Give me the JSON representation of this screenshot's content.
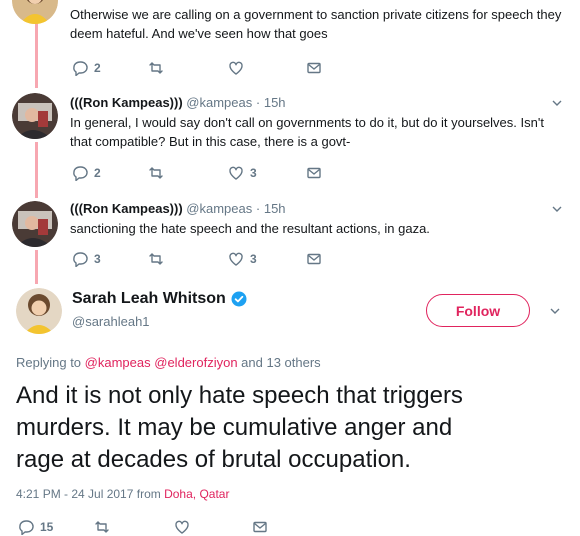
{
  "replies": [
    {
      "text_lines": [
        "Otherwise we are calling on a government to sanction private citizens for speech they",
        "deem hateful. And we've seen how that goes"
      ],
      "reply_count": "2",
      "retweet_count": "",
      "like_count": ""
    },
    {
      "name": "(((Ron Kampeas)))",
      "handle": "@kampeas",
      "separator": "·",
      "time": "15h",
      "text_lines": [
        "In general, I would say don't call on governments to do it,  but do it yourselves. Isn't",
        "that compatible? But in this case, there is a govt-"
      ],
      "reply_count": "2",
      "retweet_count": "",
      "like_count": "3"
    },
    {
      "name": "(((Ron Kampeas)))",
      "handle": "@kampeas",
      "separator": "·",
      "time": "15h",
      "text_lines": [
        "sanctioning the hate speech and the resultant actions, in gaza."
      ],
      "reply_count": "3",
      "retweet_count": "",
      "like_count": "3"
    }
  ],
  "main_tweet": {
    "name": "Sarah Leah Whitson",
    "handle": "@sarahleah1",
    "follow_label": "Follow",
    "replying_prefix": "Replying to",
    "replying_mentions": [
      "@kampeas",
      "@elderofziyon"
    ],
    "replying_suffix": "and 13 others",
    "text_lines": [
      "And it is not only hate speech that triggers",
      "murders. It may be cumulative anger and",
      "rage at decades of brutal occupation."
    ],
    "timestamp": "4:21 PM - 24 Jul 2017",
    "from_label": "from",
    "location": "Doha, Qatar",
    "reply_count": "15",
    "retweet_count": "",
    "like_count": ""
  },
  "icons": {
    "reply": "reply-icon",
    "retweet": "retweet-icon",
    "like": "heart-icon",
    "message": "envelope-icon",
    "verified": "verified-badge-icon",
    "caret": "chevron-down-icon"
  },
  "colors": {
    "accent": "#e0245e",
    "thread_line": "#f7a7b1",
    "muted": "#657786",
    "verified": "#1da1f2"
  }
}
